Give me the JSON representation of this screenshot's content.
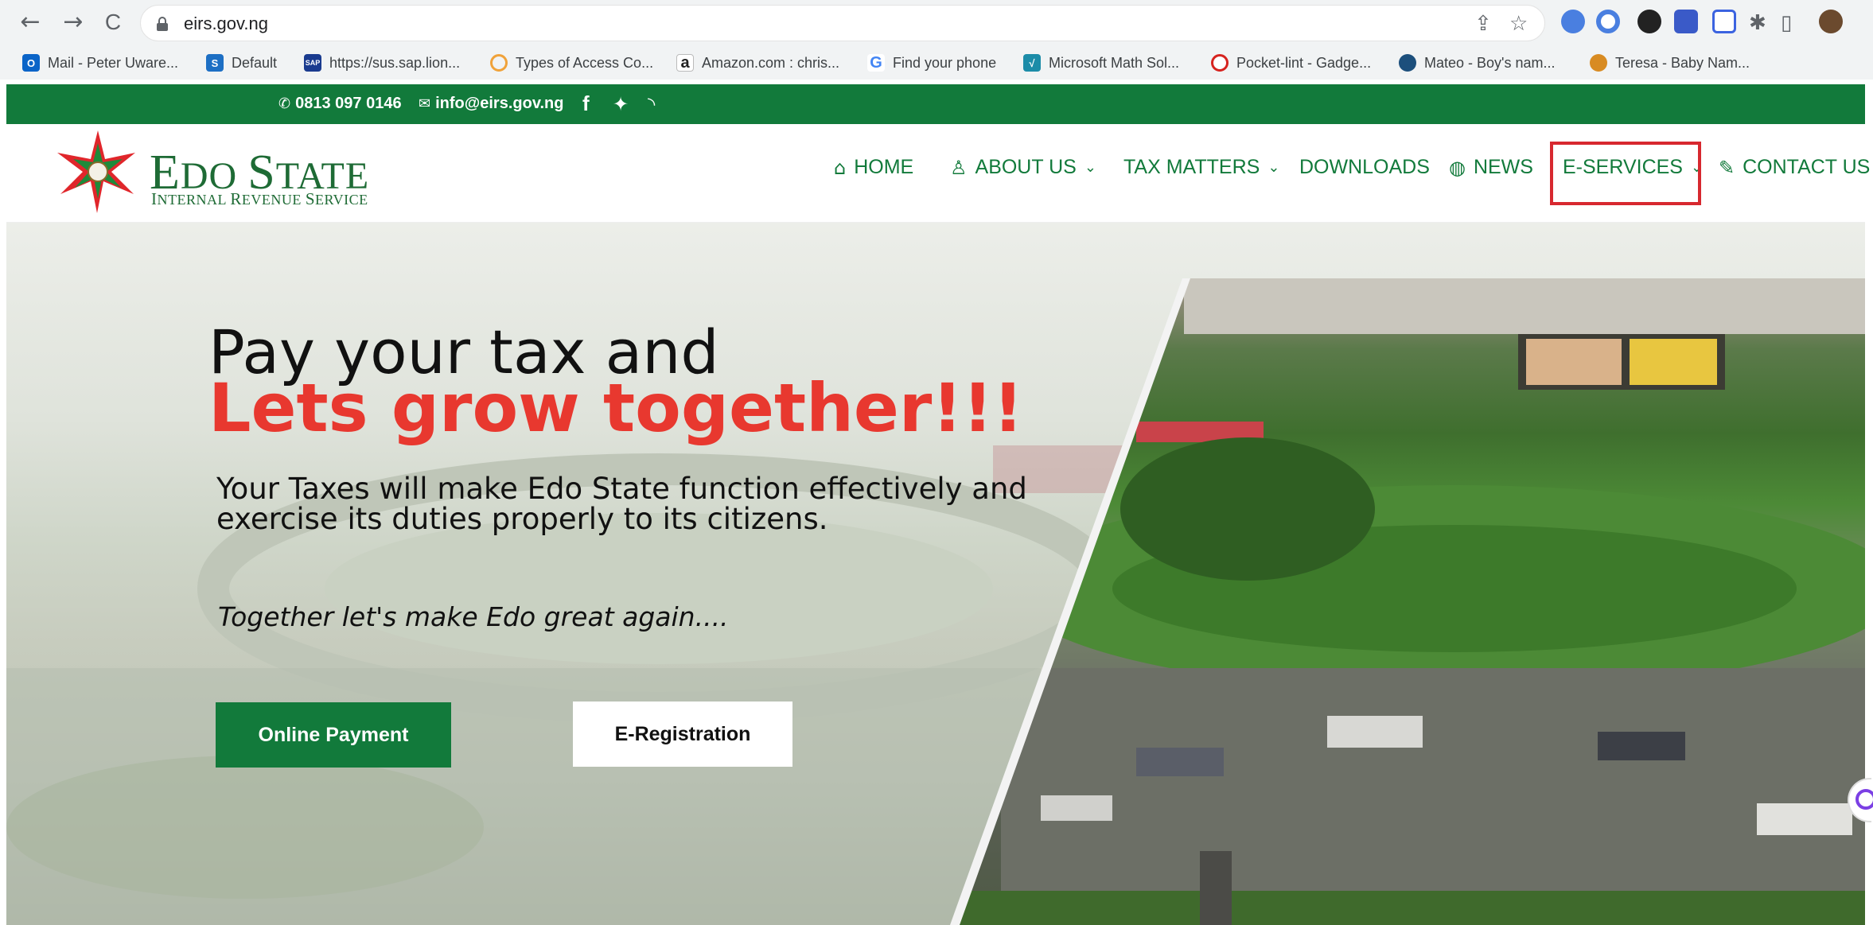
{
  "browser": {
    "url": "eirs.gov.ng",
    "nav": {
      "back": "←",
      "forward": "→",
      "reload": "C"
    },
    "omnibox_icons": [
      "share-icon",
      "star-icon"
    ],
    "bookmarks": [
      {
        "label": "Mail - Peter Uware...",
        "icon": "outlook-icon",
        "color": "#0a64c8",
        "glyph": "O"
      },
      {
        "label": "Default",
        "icon": "sharepoint-icon",
        "color": "#1d6fc4",
        "glyph": "S"
      },
      {
        "label": "https://sus.sap.lion...",
        "icon": "sap-icon",
        "color": "#1a3b8f",
        "glyph": "SAP"
      },
      {
        "label": "Types of Access Co...",
        "icon": "loader-icon",
        "color": "#f0a23a",
        "glyph": "○"
      },
      {
        "label": "Amazon.com : chris...",
        "icon": "amazon-icon",
        "color": "#222222",
        "glyph": "a"
      },
      {
        "label": "Find your phone",
        "icon": "google-icon",
        "color": "#4285f4",
        "glyph": "G"
      },
      {
        "label": "Microsoft Math Sol...",
        "icon": "math-solver-icon",
        "color": "#1c8ca8",
        "glyph": "√"
      },
      {
        "label": "Pocket-lint - Gadge...",
        "icon": "pocketlint-icon",
        "color": "#d6231f",
        "glyph": "P"
      },
      {
        "label": "Mateo - Boy's nam...",
        "icon": "mateo-icon",
        "color": "#1c4f7c",
        "glyph": "M"
      },
      {
        "label": "Teresa - Baby Nam...",
        "icon": "teresa-icon",
        "color": "#d88b22",
        "glyph": "T"
      }
    ]
  },
  "topbar": {
    "phone": "0813 097 0146",
    "email": "info@eirs.gov.ng",
    "social": [
      "facebook-icon",
      "twitter-icon",
      "rss-icon"
    ]
  },
  "header": {
    "logo_title": "Edo State",
    "logo_subtitle": "Internal Revenue Service",
    "nav": [
      {
        "label": "HOME",
        "icon": "home-icon",
        "dropdown": false
      },
      {
        "label": "ABOUT US",
        "icon": "users-icon",
        "dropdown": true
      },
      {
        "label": "TAX MATTERS",
        "icon": "",
        "dropdown": true
      },
      {
        "label": "DOWNLOADS",
        "icon": "",
        "dropdown": false
      },
      {
        "label": "NEWS",
        "icon": "globe-icon",
        "dropdown": false
      },
      {
        "label": "E-SERVICES",
        "icon": "",
        "dropdown": true,
        "highlighted": true
      },
      {
        "label": "CONTACT US",
        "icon": "wrench-icon",
        "dropdown": false
      }
    ]
  },
  "hero": {
    "line1": "Pay your tax and",
    "line2": "Lets grow together!!!",
    "tagline": "Your Taxes will make Edo State function effectively and exercise its duties properly to its citizens.",
    "motto": "Together let's make Edo great again....",
    "primary_button": "Online Payment",
    "secondary_button": "E-Registration"
  },
  "colors": {
    "brand_green": "#127a3b",
    "accent_red": "#e8382f",
    "highlight_box": "#d7282f"
  }
}
